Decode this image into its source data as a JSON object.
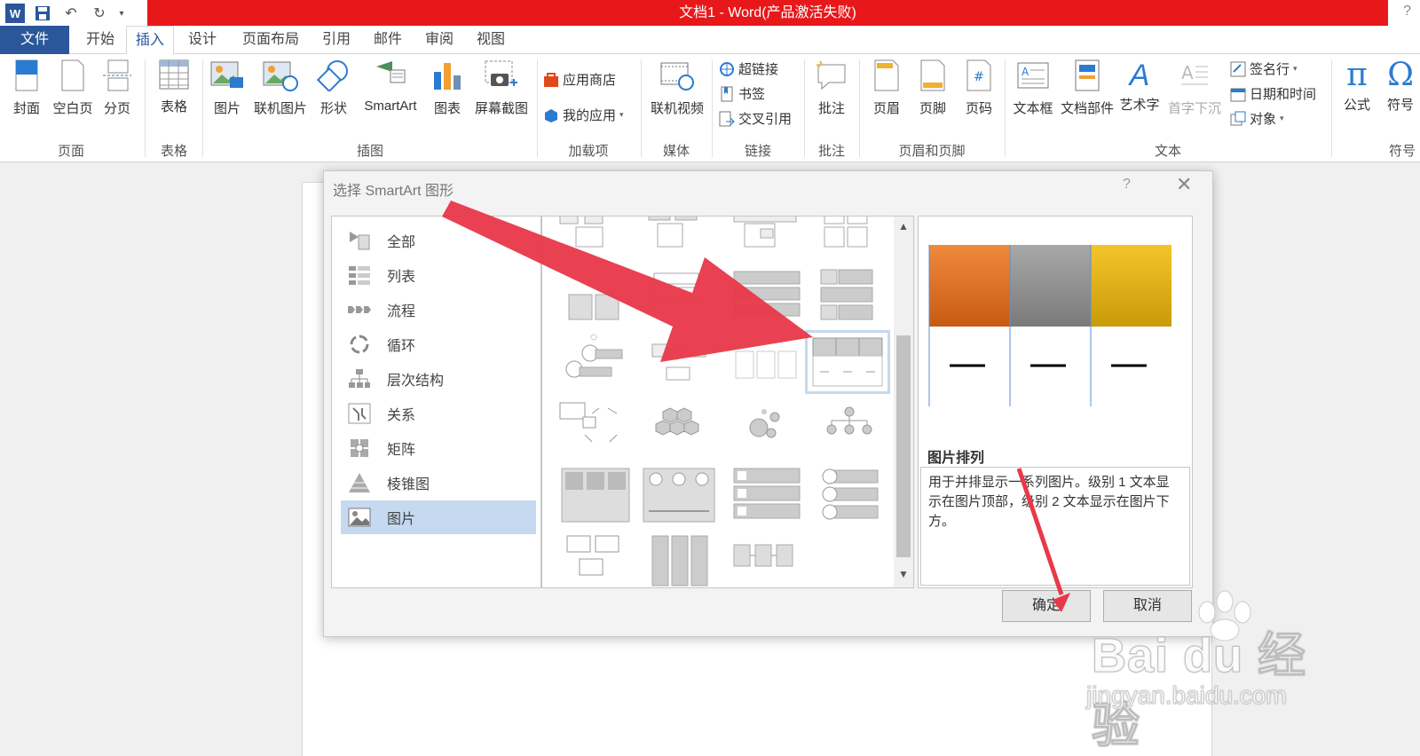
{
  "window": {
    "title": "文档1 -  Word(产品激活失败)",
    "help": "?"
  },
  "tabs": [
    {
      "label": "文件"
    },
    {
      "label": "开始"
    },
    {
      "label": "插入"
    },
    {
      "label": "设计"
    },
    {
      "label": "页面布局"
    },
    {
      "label": "引用"
    },
    {
      "label": "邮件"
    },
    {
      "label": "审阅"
    },
    {
      "label": "视图"
    }
  ],
  "ribbon": {
    "page_group": {
      "label": "页面",
      "cover": "封面",
      "blank": "空白页",
      "break": "分页"
    },
    "table_group": {
      "label": "表格",
      "table": "表格"
    },
    "illustrations_group": {
      "label": "插图",
      "picture": "图片",
      "online_picture": "联机图片",
      "shapes": "形状",
      "smartart": "SmartArt",
      "chart": "图表",
      "screenshot": "屏幕截图"
    },
    "addins_group": {
      "label": "加载项",
      "store": "应用商店",
      "my_apps": "我的应用"
    },
    "media_group": {
      "label": "媒体",
      "online_video": "联机视频"
    },
    "links_group": {
      "label": "链接",
      "hyperlink": "超链接",
      "bookmark": "书签",
      "cross_ref": "交叉引用"
    },
    "comments_group": {
      "label": "批注",
      "comment": "批注"
    },
    "header_footer_group": {
      "label": "页眉和页脚",
      "header": "页眉",
      "footer": "页脚",
      "page_number": "页码"
    },
    "text_group": {
      "label": "文本",
      "textbox": "文本框",
      "quick_parts": "文档部件",
      "wordart": "艺术字",
      "drop_cap": "首字下沉",
      "signature": "签名行",
      "datetime": "日期和时间",
      "object": "对象"
    },
    "symbols_group": {
      "label": "符号",
      "equation": "公式",
      "symbol": "符号"
    }
  },
  "dialog": {
    "title": "选择 SmartArt 图形",
    "help": "?",
    "categories": [
      {
        "label": "全部"
      },
      {
        "label": "列表"
      },
      {
        "label": "流程"
      },
      {
        "label": "循环"
      },
      {
        "label": "层次结构"
      },
      {
        "label": "关系"
      },
      {
        "label": "矩阵"
      },
      {
        "label": "棱锥图"
      },
      {
        "label": "图片"
      }
    ],
    "selected_category": "图片",
    "preview": {
      "title": "图片排列",
      "description": "用于并排显示一系列图片。级别 1 文本显示在图片顶部，级别 2 文本显示在图片下方。",
      "colors": [
        "#e4792a",
        "#8f8f8f",
        "#e6b417"
      ]
    },
    "ok": "确定",
    "cancel": "取消"
  },
  "watermark": {
    "brand": "Bai du 经验",
    "url": "jingyan.baidu.com"
  },
  "colors": {
    "title_bar": "#e8181a",
    "word_blue": "#2b579a",
    "selection": "#c5d9f1",
    "arrow": "#e8394a"
  }
}
